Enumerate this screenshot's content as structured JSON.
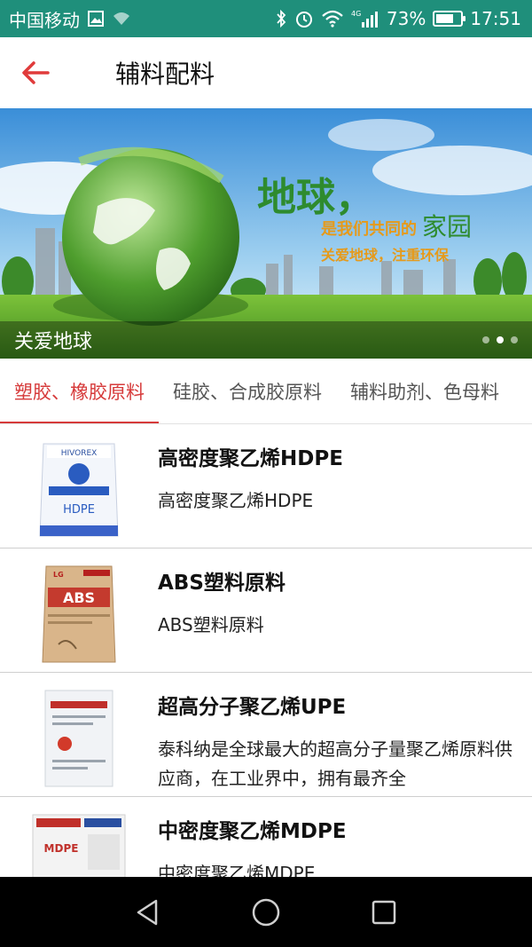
{
  "status_bar": {
    "carrier": "中国移动",
    "battery_percent": "73%",
    "battery_level": 0.73,
    "time": "17:51",
    "network": "4G"
  },
  "app_bar": {
    "title": "辅料配料",
    "back_icon": "arrow-left-icon",
    "accent_color": "#e03b3b"
  },
  "banner": {
    "caption": "关爱地球",
    "headline": "地球，",
    "line1": "是我们共同的",
    "line1_emphasis": "家园",
    "line2": "关爱地球，注重环保",
    "active_dot": 1,
    "dot_count": 3
  },
  "tabs": [
    {
      "label": "塑胶、橡胶原料",
      "active": true
    },
    {
      "label": "硅胶、合成胶原料",
      "active": false
    },
    {
      "label": "辅料助剂、色母料",
      "active": false
    }
  ],
  "products": [
    {
      "title": "高密度聚乙烯HDPE",
      "desc": "高密度聚乙烯HDPE",
      "bag_label": "HDPE",
      "bag_brand": "HIVOREX"
    },
    {
      "title": "ABS塑料原料",
      "desc": "ABS塑料原料",
      "bag_label": "ABS",
      "bag_brand": "LG"
    },
    {
      "title": "超高分子聚乙烯UPE",
      "desc": "泰科纳是全球最大的超高分子量聚乙烯原料供应商，在工业界中，拥有最齐全",
      "bag_label": "",
      "bag_brand": ""
    },
    {
      "title": "中密度聚乙烯MDPE",
      "desc": "中密度聚乙烯MDPE",
      "bag_label": "MDPE",
      "bag_brand": ""
    }
  ],
  "colors": {
    "status_bar": "#1f8f7b",
    "tab_active": "#d63a3a"
  }
}
